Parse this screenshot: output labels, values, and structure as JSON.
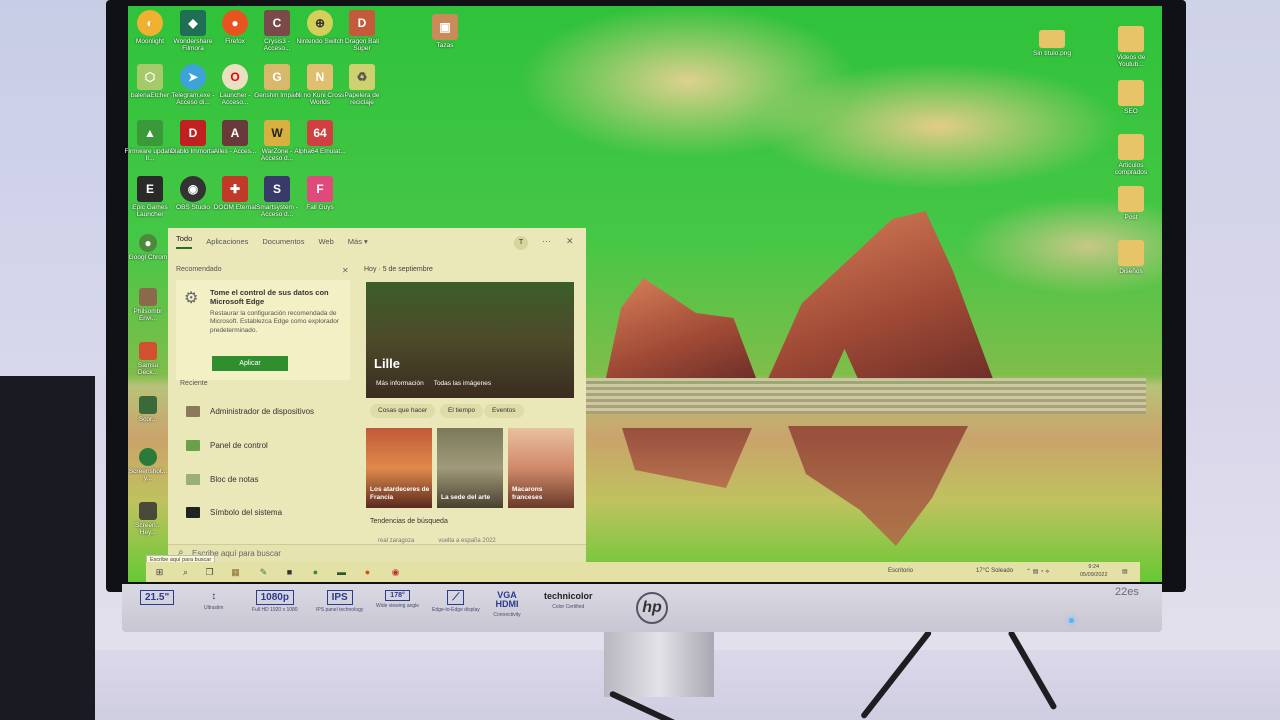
{
  "desktop_icons": {
    "row1": [
      "Moonlight",
      "Wondershare Filmora",
      "Firefox",
      "Crysis3 - Acceso...",
      "Nintendo Switch",
      "Dragon Ball Super"
    ],
    "row2": [
      "balenaEtcher",
      "Telegram.exe - Acceso di...",
      "Launcher - Acceso...",
      "Genshin Impact",
      "Ni no Kuni Cross Worlds",
      "Papelera de reciclaje"
    ],
    "row3": [
      "Firmware updater II...",
      "Diablo Immortal",
      "Alles - Acces...",
      "WarZone - Acceso d...",
      "Alpha64 Emulat...",
      ""
    ],
    "row4": [
      "Epic Games Launcher",
      "OBS Studio",
      "DOOM Eternal",
      "Smartsystem - Acceso d...",
      "Fall Guys",
      ""
    ],
    "tazas": "Tazas",
    "right_col": [
      "Sin título.png",
      "Videos de Youtub...",
      "SEO",
      "Articulos comprados",
      "Post",
      "Diseños"
    ],
    "left_col_partial": [
      "Googl Chrom",
      "Philsombr Envi...",
      "Samsu Deck...",
      "Scor...",
      "Screenshot... y...",
      "Screen... Hey..."
    ]
  },
  "start_menu": {
    "tabs": [
      "Todo",
      "Aplicaciones",
      "Documentos",
      "Web",
      "Más ▾"
    ],
    "avatar": "T",
    "more": "···",
    "close": "✕",
    "recommended_label": "Recomendado",
    "rec_close": "✕",
    "rec_title": "Tome el control de sus datos con Microsoft Edge",
    "rec_desc": "Restaurar la configuración recomendada de Microsoft. Establezca Edge como explorador predeterminado.",
    "apply_label": "Aplicar",
    "recent_label": "Reciente",
    "recent_items": [
      "Administrador de dispositivos",
      "Panel de control",
      "Bloc de notas",
      "Símbolo del sistema"
    ],
    "today_label": "Hoy",
    "date_label": "5 de septiembre",
    "hero_city": "Lille",
    "hero_more": "Más información",
    "hero_images": "Todas las imágenes",
    "chips": [
      "Cosas que hacer",
      "El tiempo",
      "Eventos"
    ],
    "cards": [
      "Los atardeceres de Francia",
      "La sede del arte",
      "Macarons franceses"
    ],
    "trend_label": "Tendencias de búsqueda",
    "trend_items": [
      "real zaragoza",
      "vuelta a españa 2022"
    ]
  },
  "search": {
    "placeholder": "Escribe aquí para buscar",
    "tooltip": "Escribe aquí para buscar"
  },
  "taskbar": {
    "desktop_label": "Escritorio",
    "weather": "17°C Soleado",
    "time": "9:24",
    "date": "05/09/2022"
  },
  "monitor": {
    "specs": [
      {
        "box": "21.5\"",
        "sub": ""
      },
      {
        "box": "↕",
        "sub": "Ultraslim"
      },
      {
        "box": "1080p",
        "sub": "Full HD 1920 x 1080"
      },
      {
        "box": "IPS",
        "sub": "IPS panel technology"
      },
      {
        "box": "178°",
        "sub": "Wide viewing angle"
      },
      {
        "box": "⟋",
        "sub": "Edge-to-Edge display"
      },
      {
        "box": "VGA HDMI",
        "sub": "Connectivity"
      },
      {
        "box": "technicolor",
        "sub": "Color Certified"
      }
    ],
    "brand": "hp",
    "model": "22es"
  },
  "colors": {
    "apply_button": "#2f8f2f",
    "menu_bg": "#eae8b8",
    "taskbar_bg": "#e4e1a6"
  }
}
